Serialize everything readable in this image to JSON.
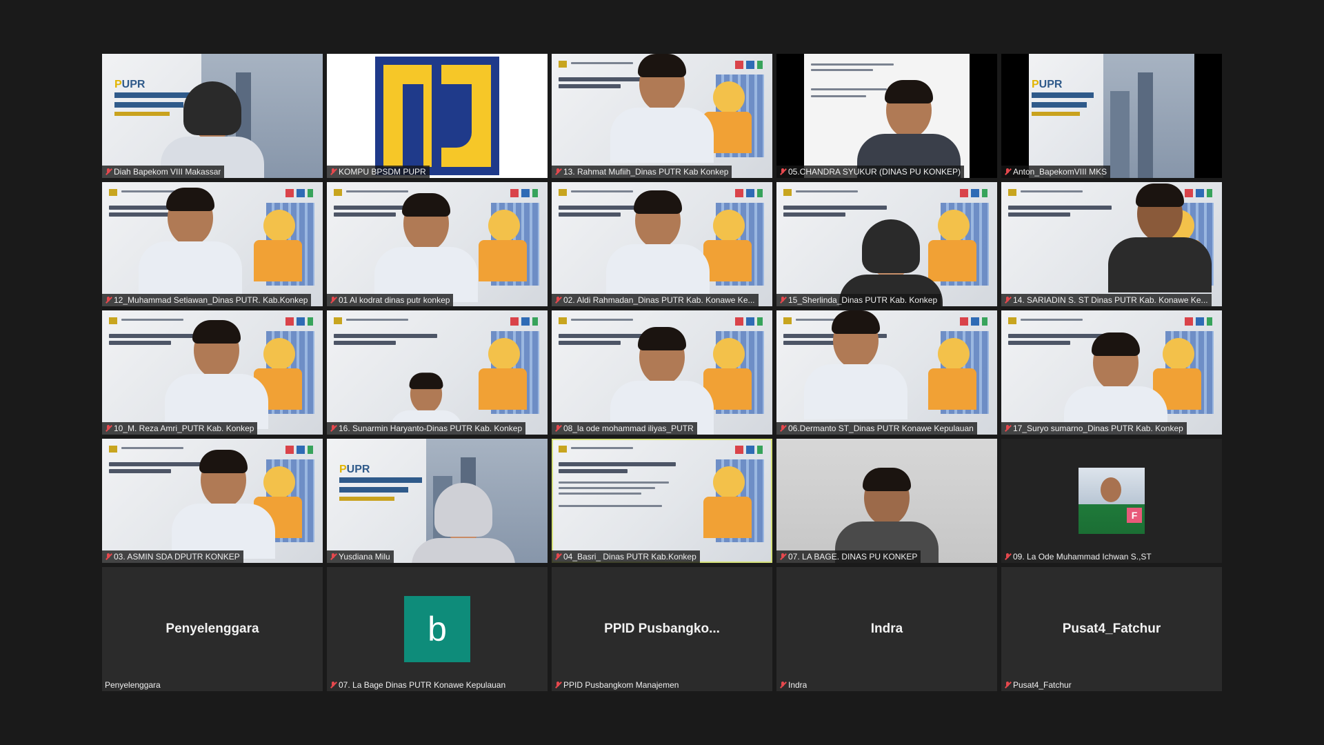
{
  "meeting": {
    "tiles": [
      {
        "name": "Diah Bapekom VIII Makassar",
        "muted": true,
        "kind": "video"
      },
      {
        "name": "KOMPU BPSDM PUPR",
        "muted": true,
        "kind": "logo"
      },
      {
        "name": "13. Rahmat Mufiih_Dinas PUTR Kab Konkep",
        "muted": true,
        "kind": "video"
      },
      {
        "name": "05.CHANDRA SYUKUR (DINAS PU KONKEP)",
        "muted": true,
        "kind": "video"
      },
      {
        "name": "Anton_BapekomVIII MKS",
        "muted": true,
        "kind": "video"
      },
      {
        "name": "12_Muhammad Setiawan_Dinas PUTR. Kab.Konkep",
        "muted": true,
        "kind": "video"
      },
      {
        "name": "01 Al kodrat dinas putr konkep",
        "muted": true,
        "kind": "video"
      },
      {
        "name": "02. Aldi Rahmadan_Dinas PUTR Kab. Konawe Ke...",
        "muted": true,
        "kind": "video"
      },
      {
        "name": "15_Sherlinda_Dinas PUTR Kab. Konkep",
        "muted": true,
        "kind": "video"
      },
      {
        "name": "14. SARIADIN S. ST Dinas PUTR Kab. Konawe Ke...",
        "muted": true,
        "kind": "video"
      },
      {
        "name": "10_M. Reza Amri_PUTR Kab. Konkep",
        "muted": true,
        "kind": "video"
      },
      {
        "name": "16. Sunarmin Haryanto-Dinas PUTR Kab. Konkep",
        "muted": true,
        "kind": "video"
      },
      {
        "name": "08_la ode mohammad iliyas_PUTR",
        "muted": true,
        "kind": "video"
      },
      {
        "name": "06.Dermanto ST_Dinas PUTR Konawe Kepulauan",
        "muted": true,
        "kind": "video"
      },
      {
        "name": "17_Suryo sumarno_Dinas PUTR Kab. Konkep",
        "muted": true,
        "kind": "video"
      },
      {
        "name": "03. ASMIN SDA DPUTR KONKEP",
        "muted": true,
        "kind": "video"
      },
      {
        "name": "Yusdiana Milu",
        "muted": true,
        "kind": "video"
      },
      {
        "name": "04_Basri_ Dinas PUTR Kab.Konkep",
        "muted": true,
        "kind": "video",
        "active_speaker": true
      },
      {
        "name": "07. LA BAGE. DINAS PU KONKEP",
        "muted": true,
        "kind": "video"
      },
      {
        "name": "09. La Ode Muhammad Ichwan S.,ST",
        "muted": true,
        "kind": "avatar-photo"
      },
      {
        "name": "Penyelenggara",
        "display": "Penyelenggara",
        "muted": false,
        "kind": "no-video"
      },
      {
        "name": "07. La Bage Dinas PUTR Konawe Kepulauan",
        "avatar_letter": "b",
        "muted": true,
        "kind": "avatar-letter",
        "accent": "#0e8c7a"
      },
      {
        "name": "PPID Pusbangkom Manajemen",
        "display": "PPID  Pusbangko...",
        "muted": true,
        "kind": "no-video"
      },
      {
        "name": "Indra",
        "display": "Indra",
        "muted": true,
        "kind": "no-video"
      },
      {
        "name": "Pusat4_Fatchur",
        "display": "Pusat4_Fatchur",
        "muted": true,
        "kind": "no-video"
      }
    ],
    "colors": {
      "background": "#1a1a1a",
      "active_speaker_border": "#d6e27a",
      "muted_icon": "#e5484d",
      "avatar_letter_bg": "#0e8c7a"
    },
    "icons": {
      "muted": "mic-muted-icon"
    }
  }
}
